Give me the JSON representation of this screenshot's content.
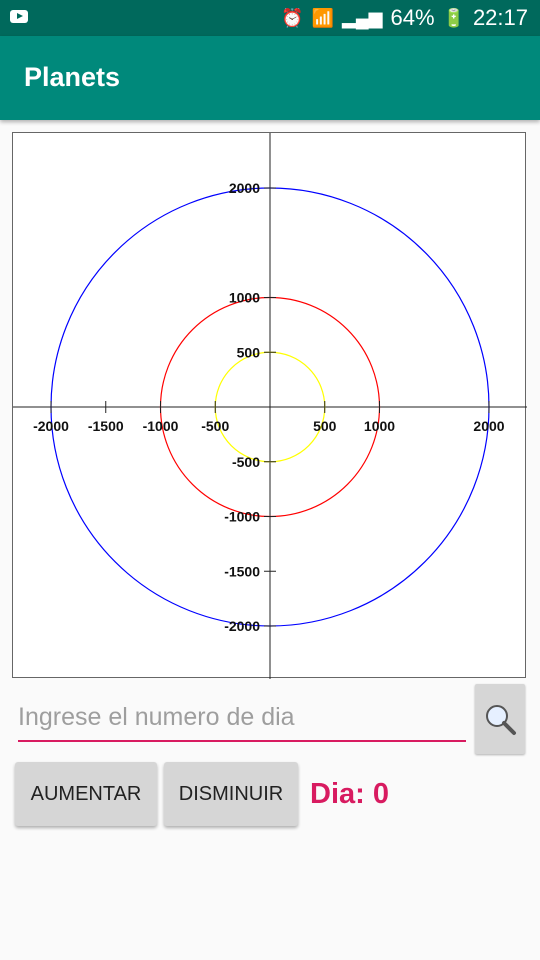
{
  "status_bar": {
    "alarm_icon": "alarm-icon",
    "wifi_icon": "wifi-icon",
    "signal_icon": "signal-icon",
    "battery_percent": "64%",
    "battery_icon": "battery-charging-icon",
    "time": "22:17"
  },
  "app_bar": {
    "title": "Planets"
  },
  "plot": {
    "x_ticks": [
      "-2000",
      "-1500",
      "-1000",
      "-500",
      "500",
      "1000",
      "2000"
    ],
    "y_ticks": [
      "2000",
      "1000",
      "500",
      "-500",
      "-1000",
      "-1500",
      "-2000"
    ],
    "orbits": [
      {
        "name": "orbit-yellow",
        "radius": 500,
        "color": "#ffff00"
      },
      {
        "name": "orbit-red",
        "radius": 1000,
        "color": "#ff0000"
      },
      {
        "name": "orbit-blue",
        "radius": 2000,
        "color": "#0000ff"
      }
    ]
  },
  "day_input": {
    "placeholder": "Ingrese el numero de dia",
    "value": ""
  },
  "buttons": {
    "increase": "AUMENTAR",
    "decrease": "DISMINUIR"
  },
  "day_label": "Dia: 0",
  "colors": {
    "accent": "#d81b60",
    "primary": "#00897b",
    "primary_dark": "#00695c"
  }
}
